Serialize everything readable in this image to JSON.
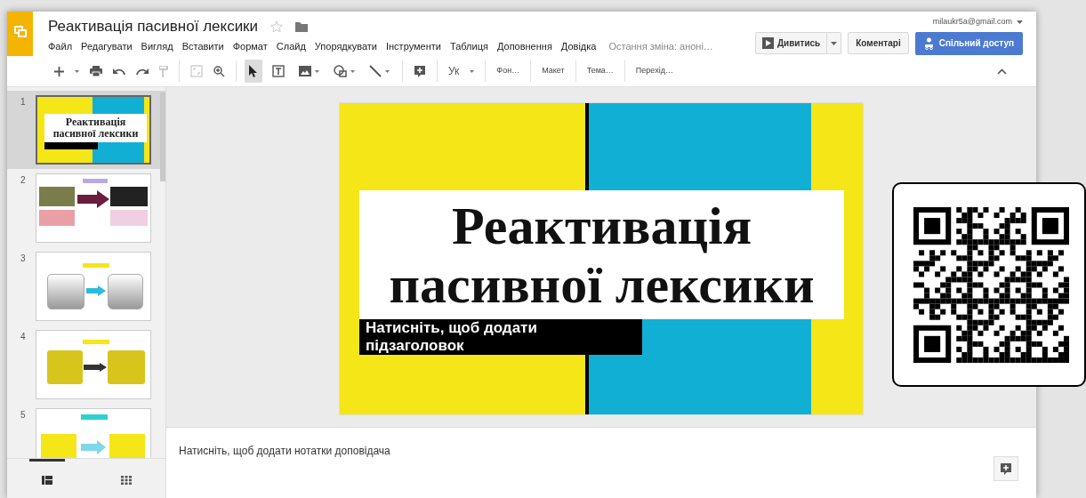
{
  "header": {
    "title": "Реактивація пасивної лексики",
    "starred": false,
    "menu": [
      "Файл",
      "Редагувати",
      "Вигляд",
      "Вставити",
      "Формат",
      "Слайд",
      "Упорядкувати",
      "Інструменти",
      "Таблиця",
      "Доповнення",
      "Довідка"
    ],
    "last_edit": "Остання зміна: анонi…",
    "account": "milaukr5a@gmail.com",
    "present_button": "Дивитись",
    "comments_button": "Коментарі",
    "share_button": "Спільний доступ"
  },
  "toolbar": {
    "tools": [
      {
        "kind": "select",
        "selected": true
      },
      {
        "kind": "textbox",
        "selected": false
      },
      {
        "kind": "image",
        "selected": false
      },
      {
        "kind": "shape",
        "selected": false
      },
      {
        "kind": "line",
        "selected": false
      }
    ],
    "input_tool": "Ук",
    "text_buttons": [
      "Фон…",
      "Макет",
      "Тема…",
      "Перехід…"
    ]
  },
  "slides": [
    {
      "number": "1",
      "kind": "title",
      "selected": true,
      "title": "Реактивація пасивної лексики"
    },
    {
      "number": "2",
      "kind": "photo-arrow",
      "selected": false
    },
    {
      "number": "3",
      "kind": "gray-boxes",
      "selected": false
    },
    {
      "number": "4",
      "kind": "yellow-boxes",
      "selected": false
    },
    {
      "number": "5",
      "kind": "yellow-notes",
      "selected": false
    }
  ],
  "views": [
    {
      "kind": "filmstrip",
      "selected": true
    },
    {
      "kind": "grid",
      "selected": false
    }
  ],
  "slide": {
    "title": "Реактивація пасивної лексики",
    "subtitle_placeholder": "Натисніть, щоб додати підзаголовок"
  },
  "notes": {
    "placeholder": "Натисніть, щоб додати нотатки доповідача"
  }
}
